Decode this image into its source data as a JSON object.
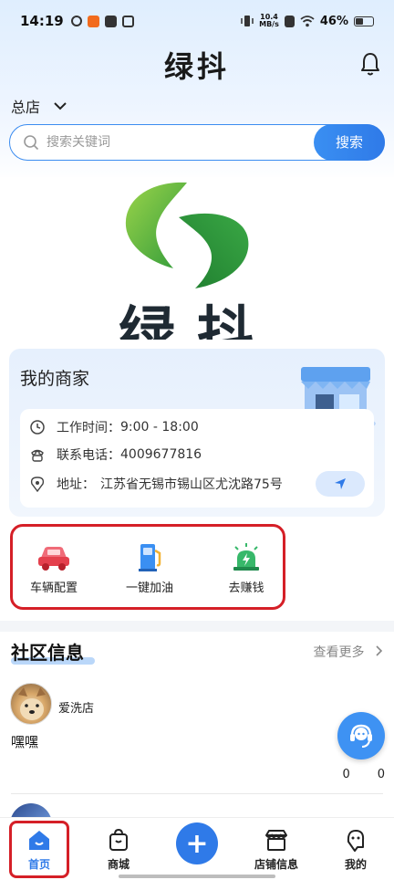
{
  "status_bar": {
    "time": "14:19",
    "net_speed_top": "10.4",
    "net_speed_unit": "MB/s",
    "battery": "46%"
  },
  "header": {
    "title": "绿抖",
    "store_selector": "总店"
  },
  "search": {
    "placeholder": "搜索关键词",
    "button_label": "搜索"
  },
  "banner": {
    "logo_text": "绿抖"
  },
  "merchant": {
    "title": "我的商家",
    "hours_label": "工作时间：",
    "hours_value": "9:00 - 18:00",
    "phone_label": "联系电话：",
    "phone_value": "4009677816",
    "address_label": "地址：",
    "address_value": "江苏省无锡市锡山区尤沈路75号"
  },
  "quick_actions": [
    {
      "label": "车辆配置",
      "icon": "car-icon"
    },
    {
      "label": "一键加油",
      "icon": "fuel-pump-icon"
    },
    {
      "label": "去赚钱",
      "icon": "siren-icon"
    }
  ],
  "community": {
    "title": "社区信息",
    "more_label": "查看更多",
    "post": {
      "user": "爱洗店",
      "content": "嘿嘿",
      "count_a": "0",
      "count_b": "0"
    }
  },
  "tabbar": {
    "items": [
      {
        "label": "首页",
        "icon": "home-icon"
      },
      {
        "label": "商城",
        "icon": "shopping-bag-icon"
      },
      {
        "label": "",
        "icon": "plus-icon"
      },
      {
        "label": "店铺信息",
        "icon": "storefront-icon"
      },
      {
        "label": "我的",
        "icon": "profile-icon"
      }
    ]
  },
  "colors": {
    "accent": "#2f7ae8",
    "highlight_box": "#d51f27",
    "card_bg": "#e6f0fd"
  }
}
